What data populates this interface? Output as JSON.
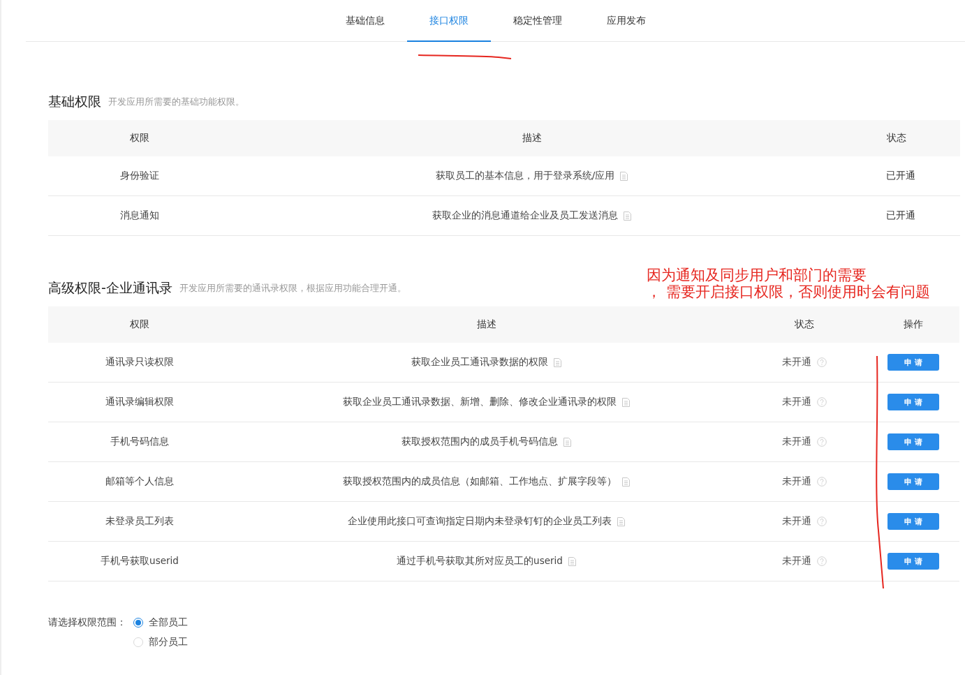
{
  "tabs": [
    {
      "label": "基础信息",
      "selected": false
    },
    {
      "label": "接口权限",
      "selected": true
    },
    {
      "label": "稳定性管理",
      "selected": false
    },
    {
      "label": "应用发布",
      "selected": false
    }
  ],
  "sections": [
    {
      "title": "基础权限",
      "subtitle": "开发应用所需要的基础功能权限。",
      "columns": [
        "权限",
        "描述",
        "状态"
      ],
      "rows": [
        {
          "name": "身份验证",
          "description": "获取员工的基本信息，用于登录系统/应用",
          "status": "已开通",
          "enabled": true
        },
        {
          "name": "消息通知",
          "description": "获取企业的消息通道给企业及员工发送消息",
          "status": "已开通",
          "enabled": true
        }
      ]
    },
    {
      "title": "高级权限-企业通讯录",
      "subtitle": "开发应用所需要的通讯录权限，根据应用功能合理开通。",
      "columns": [
        "权限",
        "描述",
        "状态",
        "操作"
      ],
      "rows": [
        {
          "name": "通讯录只读权限",
          "description": "获取企业员工通讯录数据的权限",
          "status": "未开通",
          "enabled": false,
          "action": "申 请"
        },
        {
          "name": "通讯录编辑权限",
          "description": "获取企业员工通讯录数据、新增、删除、修改企业通讯录的权限",
          "status": "未开通",
          "enabled": false,
          "action": "申 请"
        },
        {
          "name": "手机号码信息",
          "description": "获取授权范围内的成员手机号码信息",
          "status": "未开通",
          "enabled": false,
          "action": "申 请"
        },
        {
          "name": "邮箱等个人信息",
          "description": "获取授权范围内的成员信息（如邮箱、工作地点、扩展字段等）",
          "status": "未开通",
          "enabled": false,
          "action": "申 请"
        },
        {
          "name": "未登录员工列表",
          "description": "企业使用此接口可查询指定日期内未登录钉钉的企业员工列表",
          "status": "未开通",
          "enabled": false,
          "action": "申 请"
        },
        {
          "name": "手机号获取userid",
          "description": "通过手机号获取其所对应员工的userid",
          "status": "未开通",
          "enabled": false,
          "action": "申 请"
        }
      ]
    }
  ],
  "annotation": {
    "lines": [
      "因为通知及同步用户和部门的需要",
      "， 需要开启接口权限，否则使用时会有问题"
    ]
  },
  "scope": {
    "label": "请选择权限范围：",
    "options": [
      {
        "label": "全部员工",
        "selected": true
      },
      {
        "label": "部分员工",
        "selected": false
      }
    ]
  }
}
